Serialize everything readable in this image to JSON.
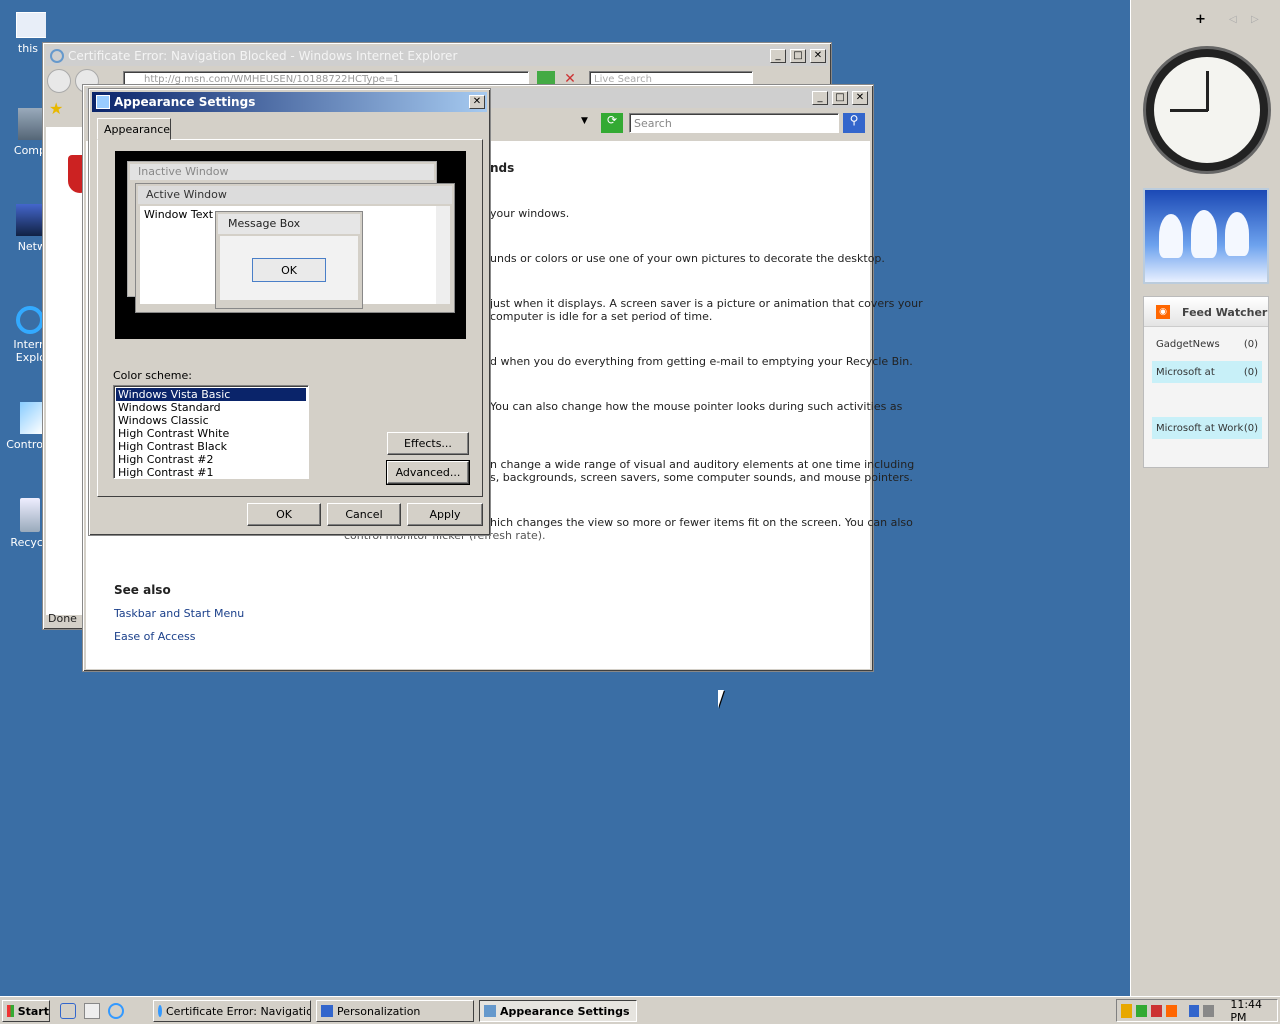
{
  "desktop": {
    "icons": [
      {
        "label": "this",
        "icon": "computer-icon"
      },
      {
        "label": "Comp",
        "icon": "computer-icon"
      },
      {
        "label": "Netw",
        "icon": "network-icon"
      },
      {
        "label": "Intern\nExplo",
        "icon": "ie-icon"
      },
      {
        "label": "Control",
        "icon": "control-panel-icon"
      },
      {
        "label": "Recycl",
        "icon": "recycle-bin-icon"
      }
    ]
  },
  "ie_window": {
    "title": "Certificate Error: Navigation Blocked - Windows Internet Explorer",
    "address": "http://g.msn.com/WMHEUSEN/10188722HCType=1",
    "search_placeholder": "Live Search",
    "status": "Done"
  },
  "personalization_window": {
    "search_placeholder": "Search",
    "heading_fragment": "nds",
    "paragraphs": [
      "your windows.",
      "unds or colors or use one of your own pictures to decorate the desktop.",
      "just when it displays. A screen saver is a picture or animation that covers your",
      "computer is idle for a set period of time.",
      "d when you do everything from getting e-mail to emptying your Recycle Bin.",
      "You can also change how the mouse pointer looks during such activities as",
      "n change a wide range of visual and auditory elements at one time including",
      "s, backgrounds, screen savers, some computer sounds, and mouse pointers.",
      "hich changes the view so more or fewer items fit on the screen. You can also",
      "control monitor flicker (refresh rate)."
    ],
    "see_also": {
      "heading": "See also",
      "links": [
        "Taskbar and Start Menu",
        "Ease of Access"
      ]
    }
  },
  "appearance_dialog": {
    "title": "Appearance Settings",
    "tab": "Appearance",
    "preview": {
      "inactive_title": "Inactive Window",
      "active_title": "Active Window",
      "window_text": "Window Text",
      "msgbox_title": "Message Box",
      "msgbox_ok": "OK"
    },
    "color_scheme_label": "Color scheme:",
    "schemes": [
      "Windows Vista Basic",
      "Windows Standard",
      "Windows Classic",
      "High Contrast White",
      "High Contrast Black",
      "High Contrast #2",
      "High Contrast #1"
    ],
    "selected_scheme": "Windows Vista Basic",
    "effects_button": "Effects...",
    "advanced_button": "Advanced...",
    "ok_button": "OK",
    "cancel_button": "Cancel",
    "apply_button": "Apply"
  },
  "sidebar": {
    "add_label": "+",
    "feed": {
      "title": "Feed Watcher",
      "items": [
        {
          "name": "GadgetNews",
          "count": "(0)"
        },
        {
          "name": "Microsoft at",
          "count": "(0)"
        },
        {
          "name": "Microsoft at Work",
          "count": "(0)"
        }
      ]
    }
  },
  "taskbar": {
    "start": "Start",
    "tasks": [
      {
        "label": "Certificate Error: Navigatio..."
      },
      {
        "label": "Personalization"
      },
      {
        "label": "Appearance Settings"
      }
    ],
    "clock": "11:44 PM"
  },
  "colors": {
    "desktop": "#3a6ea5",
    "active_title_start": "#0a246a",
    "active_title_end": "#a6caf0",
    "selection": "#0a246a",
    "feed_highlight": "#c8f0f8"
  }
}
